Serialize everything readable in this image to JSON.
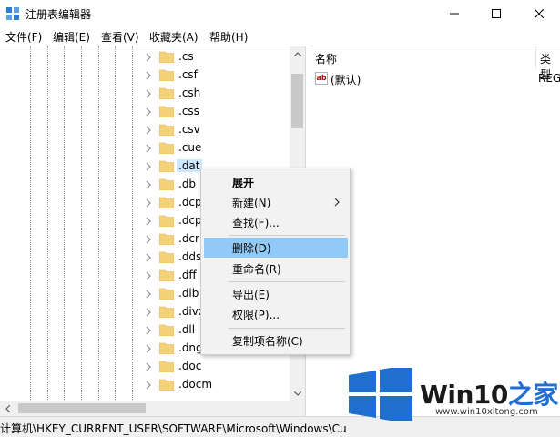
{
  "window": {
    "title": "注册表编辑器"
  },
  "menu": [
    "文件(F)",
    "编辑(E)",
    "查看(V)",
    "收藏夹(A)",
    "帮助(H)"
  ],
  "tree": {
    "items": [
      ".cs",
      ".csf",
      ".csh",
      ".css",
      ".csv",
      ".cue",
      ".dat",
      ".db",
      ".dcp",
      ".dcp",
      ".dcr",
      ".dds",
      ".dff",
      ".dib",
      ".divx",
      ".dll",
      ".dng",
      ".doc",
      ".docm"
    ],
    "selected": ".dat"
  },
  "values": {
    "col_name": "名称",
    "col_type": "类型",
    "rows": [
      {
        "name": "(默认)",
        "type": "REG"
      }
    ]
  },
  "context_menu": {
    "items": [
      {
        "label": "展开",
        "bold": true
      },
      {
        "label": "新建(N)",
        "submenu": true
      },
      {
        "label": "查找(F)..."
      },
      {
        "label": "删除(D)",
        "highlighted": true
      },
      {
        "label": "重命名(R)"
      },
      {
        "label": "导出(E)"
      },
      {
        "label": "权限(P)..."
      },
      {
        "label": "复制项名称(C)"
      }
    ]
  },
  "status": {
    "path": "计算机\\HKEY_CURRENT_USER\\SOFTWARE\\Microsoft\\Windows\\Cu"
  },
  "watermark": {
    "brand": "Win10",
    "brand_suffix": "之家",
    "url": "www.win10xitong.com",
    "logo_color": "#1f6fd0"
  },
  "colors": {
    "selection": "#cce8ff",
    "menu_highlight": "#91c9f7",
    "folder": "#f4d27a"
  }
}
